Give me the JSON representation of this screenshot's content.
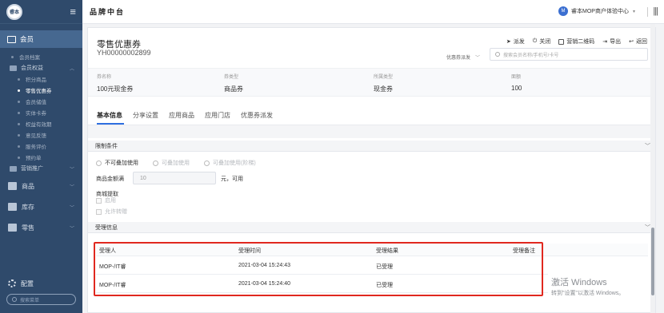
{
  "sidebar": {
    "logo_text": "睿本",
    "top_item": "会员",
    "items": [
      {
        "label": "会员档案"
      },
      {
        "label": "会员权益",
        "type": "group"
      },
      {
        "label": "积分商品"
      },
      {
        "label": "零售优惠券",
        "active": true
      },
      {
        "label": "会员储值"
      },
      {
        "label": "实体卡券"
      },
      {
        "label": "权益有效期"
      },
      {
        "label": "意见反馈"
      },
      {
        "label": "服务评价"
      },
      {
        "label": "预约单"
      },
      {
        "label": "营销推广",
        "type": "group"
      }
    ],
    "main_items": [
      {
        "label": "商品"
      },
      {
        "label": "库存"
      },
      {
        "label": "零售"
      }
    ],
    "config_label": "配置",
    "search_placeholder": "搜索菜单"
  },
  "header": {
    "title": "品牌中台",
    "user_avatar": "M",
    "user_name": "睿本MOP商户体验中心"
  },
  "page": {
    "title": "零售优惠券",
    "code": "YH00000002899",
    "actions": [
      "派发",
      "关闭",
      "营销二维码",
      "导出",
      "返回"
    ],
    "select_label": "优惠券派发",
    "search_placeholder": "搜索会员名称/手机号/卡号"
  },
  "info": [
    {
      "label": "券名称",
      "value": "100元现金券"
    },
    {
      "label": "券类型",
      "value": "商品券"
    },
    {
      "label": "所属类型",
      "value": "现金券"
    },
    {
      "label": "面额",
      "value": "100"
    }
  ],
  "tabs": [
    "基本信息",
    "分享设置",
    "应用商品",
    "应用门店",
    "优惠券派发"
  ],
  "restrict": {
    "section_title": "限制条件",
    "radios": [
      "不可叠加使用",
      "可叠加使用",
      "可叠加使用(阶梯)"
    ],
    "amount_label": "商品金额满",
    "amount_value": "10",
    "amount_suffix": "元，可用",
    "mall_label": "商城提取",
    "checks": [
      "启用",
      "允许转赠"
    ]
  },
  "accept": {
    "section_title": "受理信息",
    "columns": [
      "受理人",
      "受理时间",
      "受理结果",
      "受理备注"
    ],
    "rows": [
      [
        "MOP-/IT睿",
        "2021-03-04 15:24:43",
        "已受理",
        ""
      ],
      [
        "MOP-/IT睿",
        "2021-03-04 15:24:40",
        "已受理",
        ""
      ]
    ]
  },
  "watermark": {
    "line1": "激活 Windows",
    "line2": "转到\"设置\"以激活 Windows。"
  }
}
